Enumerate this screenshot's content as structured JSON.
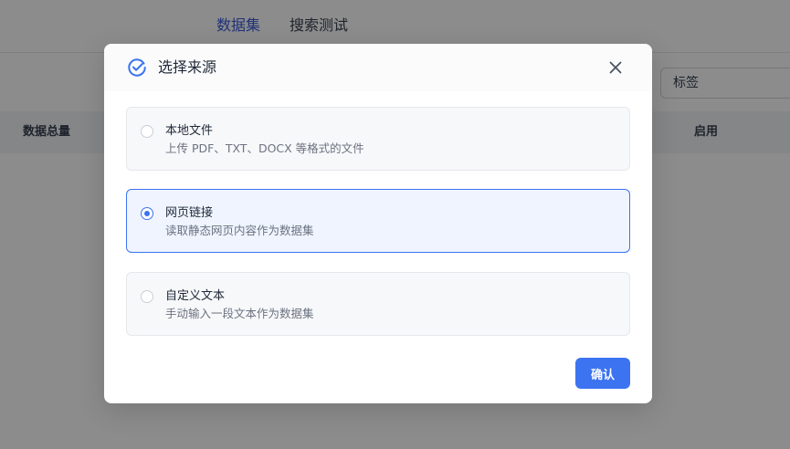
{
  "background": {
    "tabs": [
      {
        "label": "数据集",
        "active": true
      },
      {
        "label": "搜索测试",
        "active": false
      }
    ],
    "tag_input": {
      "placeholder": "标签"
    },
    "table_headers": {
      "total": "数据总量",
      "enabled": "启用"
    }
  },
  "modal": {
    "title": "选择来源",
    "options": [
      {
        "title": "本地文件",
        "description": "上传 PDF、TXT、DOCX 等格式的文件",
        "selected": false
      },
      {
        "title": "网页链接",
        "description": "读取静态网页内容作为数据集",
        "selected": true
      },
      {
        "title": "自定义文本",
        "description": "手动输入一段文本作为数据集",
        "selected": false
      }
    ],
    "confirm_label": "确认"
  },
  "colors": {
    "accent": "#3b73f0",
    "selected_bg": "#eff4ff",
    "tab_active": "#3b5bdb"
  },
  "icons": {
    "modal_icon": "check-circle-icon",
    "close": "close-icon"
  }
}
